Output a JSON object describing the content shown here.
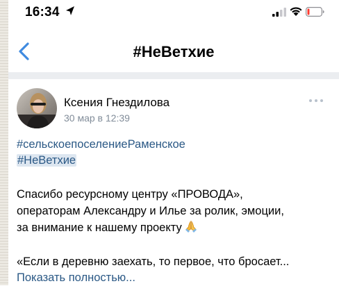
{
  "status_bar": {
    "time": "16:34"
  },
  "nav": {
    "title": "#НеВетхие"
  },
  "post": {
    "author": "Ксения Гнездилова",
    "date": "30 мар в 12:39",
    "hashtags": [
      "#сельскоепоселениеРаменское",
      "#НеВетхие"
    ],
    "paragraph1_lines": [
      "Спасибо ресурсному центру «ПРОВОДА»,",
      "операторам Александру и Илье за ролик, эмоции,",
      "за внимание к нашему проекту"
    ],
    "emoji": "praying-hands-emoji",
    "paragraph2_line": "«Если в деревню заехать, то первое, что бросает...",
    "show_more": "Показать полностью..."
  },
  "colors": {
    "link": "#2a5885",
    "date_gray": "#818c99",
    "back_blue": "#3f8ae0",
    "divider": "#ebedf0"
  }
}
